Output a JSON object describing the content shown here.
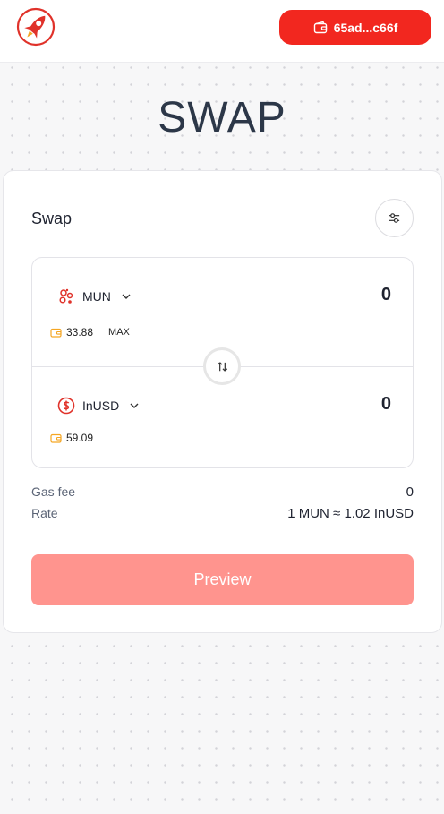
{
  "header": {
    "wallet_label": "65ad...c66f"
  },
  "page": {
    "title": "SWAP"
  },
  "card": {
    "title": "Swap"
  },
  "from_token": {
    "name": "MUN",
    "amount": "0",
    "balance": "33.88",
    "max_label": "MAX",
    "icon": "mun-token-icon"
  },
  "to_token": {
    "name": "InUSD",
    "amount": "0",
    "balance": "59.09",
    "icon": "dollar-coin-icon"
  },
  "info": {
    "gas_fee_label": "Gas fee",
    "gas_fee_value": "0",
    "rate_label": "Rate",
    "rate_value": "1 MUN ≈ 1.02 InUSD"
  },
  "actions": {
    "preview_label": "Preview"
  },
  "colors": {
    "accent": "#f2271f",
    "preview_disabled": "#ff948e",
    "balance_icon": "#f5a623"
  }
}
